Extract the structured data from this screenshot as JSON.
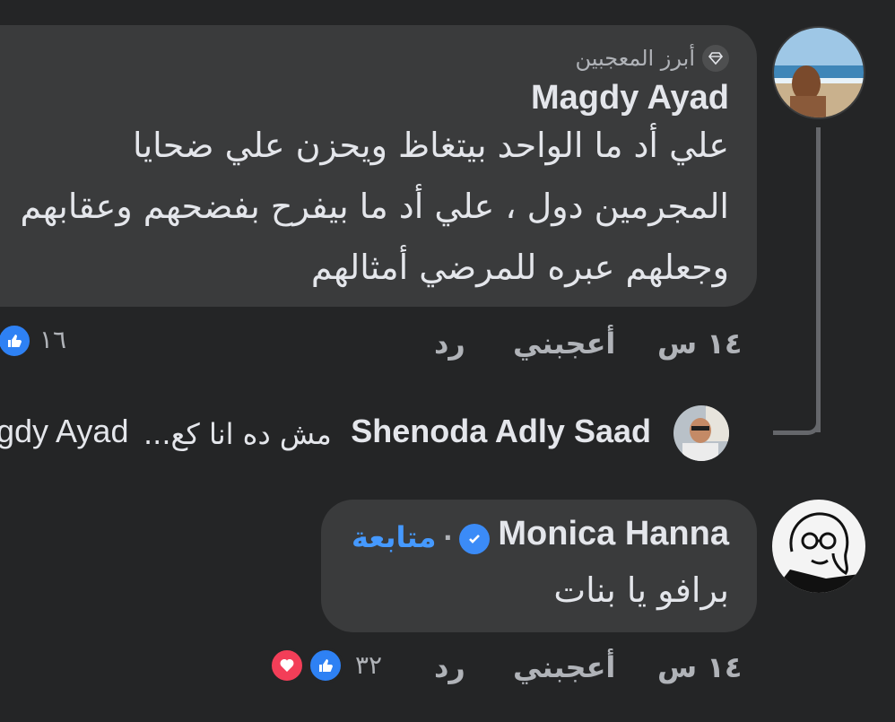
{
  "thread": {
    "top_comment": {
      "badge_label": "أبرز المعجبين",
      "author": "Magdy Ayad",
      "text_lines": [
        "علي أد ما الواحد بيتغاظ ويحزن علي ضحايا",
        "المجرمين دول ، علي أد ما بيفرح بفضحهم وعقابهم",
        "وجعلهم عبره للمرضي أمثالهم"
      ],
      "time": "١٤ س",
      "like_label": "أعجبني",
      "reply_label": "رد",
      "reaction_count": "١٦"
    },
    "reply": {
      "author": "Shenoda Adly Saad",
      "preview": "مش ده انا كع...",
      "mention": "gdy Ayad"
    },
    "second_comment": {
      "author": "Monica Hanna",
      "dot": "·",
      "follow_label": "متابعة",
      "text": "برافو يا بنات",
      "time": "١٤ س",
      "like_label": "أعجبني",
      "reply_label": "رد",
      "reaction_count": "٣٢"
    }
  },
  "colors": {
    "background": "#242526",
    "bubble": "#3a3b3c",
    "text": "#e4e6eb",
    "muted": "#b0b3b8",
    "link": "#4599ff",
    "like": "#2e81f4",
    "love": "#f33e58"
  }
}
